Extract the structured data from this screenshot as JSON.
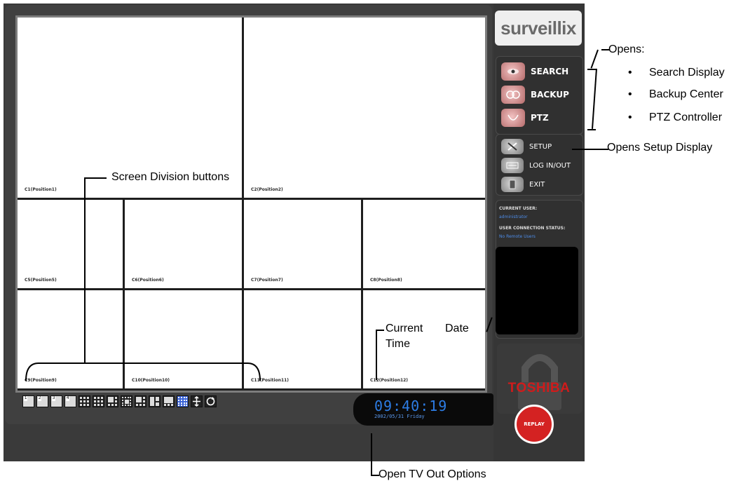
{
  "app": {
    "logo_text": "surveillix",
    "brand": "TOSHIBA"
  },
  "cameras": [
    {
      "label": "C1(Position1)"
    },
    {
      "label": "C2(Position2)"
    },
    {
      "label": "C5(Position5)"
    },
    {
      "label": "C6(Position6)"
    },
    {
      "label": "C7(Position7)"
    },
    {
      "label": "C8(Position8)"
    },
    {
      "label": "C9(Position9)"
    },
    {
      "label": "C10(Position10)"
    },
    {
      "label": "C11(Position11)"
    },
    {
      "label": "C12(Position12)"
    }
  ],
  "toolbar": {
    "buttons": [
      {
        "name": "split-1-button",
        "num": "1"
      },
      {
        "name": "split-2-button",
        "num": "2"
      },
      {
        "name": "split-3-button",
        "num": "3"
      },
      {
        "name": "split-4-button",
        "num": "4"
      },
      {
        "name": "split-9-button",
        "num": ""
      },
      {
        "name": "split-9b-button",
        "num": ""
      },
      {
        "name": "split-10-button",
        "num": ""
      },
      {
        "name": "split-13-button",
        "num": ""
      },
      {
        "name": "split-16-button",
        "num": ""
      },
      {
        "name": "split-7-button",
        "num": ""
      },
      {
        "name": "split-8-button",
        "num": ""
      },
      {
        "name": "split-10b-button",
        "num": ""
      }
    ],
    "move_icon": "move-arrows-icon",
    "cycle_icon": "sequence-cycle-icon"
  },
  "clock": {
    "time": "09:40:19",
    "date": "2002/05/31 Friday"
  },
  "menu": {
    "search": "SEARCH",
    "backup": "BACKUP",
    "ptz": "PTZ",
    "setup": "SETUP",
    "login": "LOG IN/OUT",
    "exit": "EXIT",
    "replay": "REPLAY"
  },
  "status": {
    "current_user_label": "CURRENT USER:",
    "current_user": "administrator",
    "connection_label": "USER CONNECTION STATUS:",
    "connection": "No Remote Users"
  },
  "annotations": {
    "opens": "Opens:",
    "opens_items": [
      "Search Display",
      "Backup Center",
      "PTZ Controller"
    ],
    "setup": "Opens Setup Display",
    "screen_division": "Screen Division buttons",
    "current": "Current",
    "date": "Date",
    "time": "Time",
    "tv_out": "Open TV Out Options"
  },
  "colors": {
    "clock_blue": "#2d7de5",
    "status_blue": "#4d8ce8",
    "replay_red": "#d42222",
    "brand_red": "#d01b1b"
  }
}
